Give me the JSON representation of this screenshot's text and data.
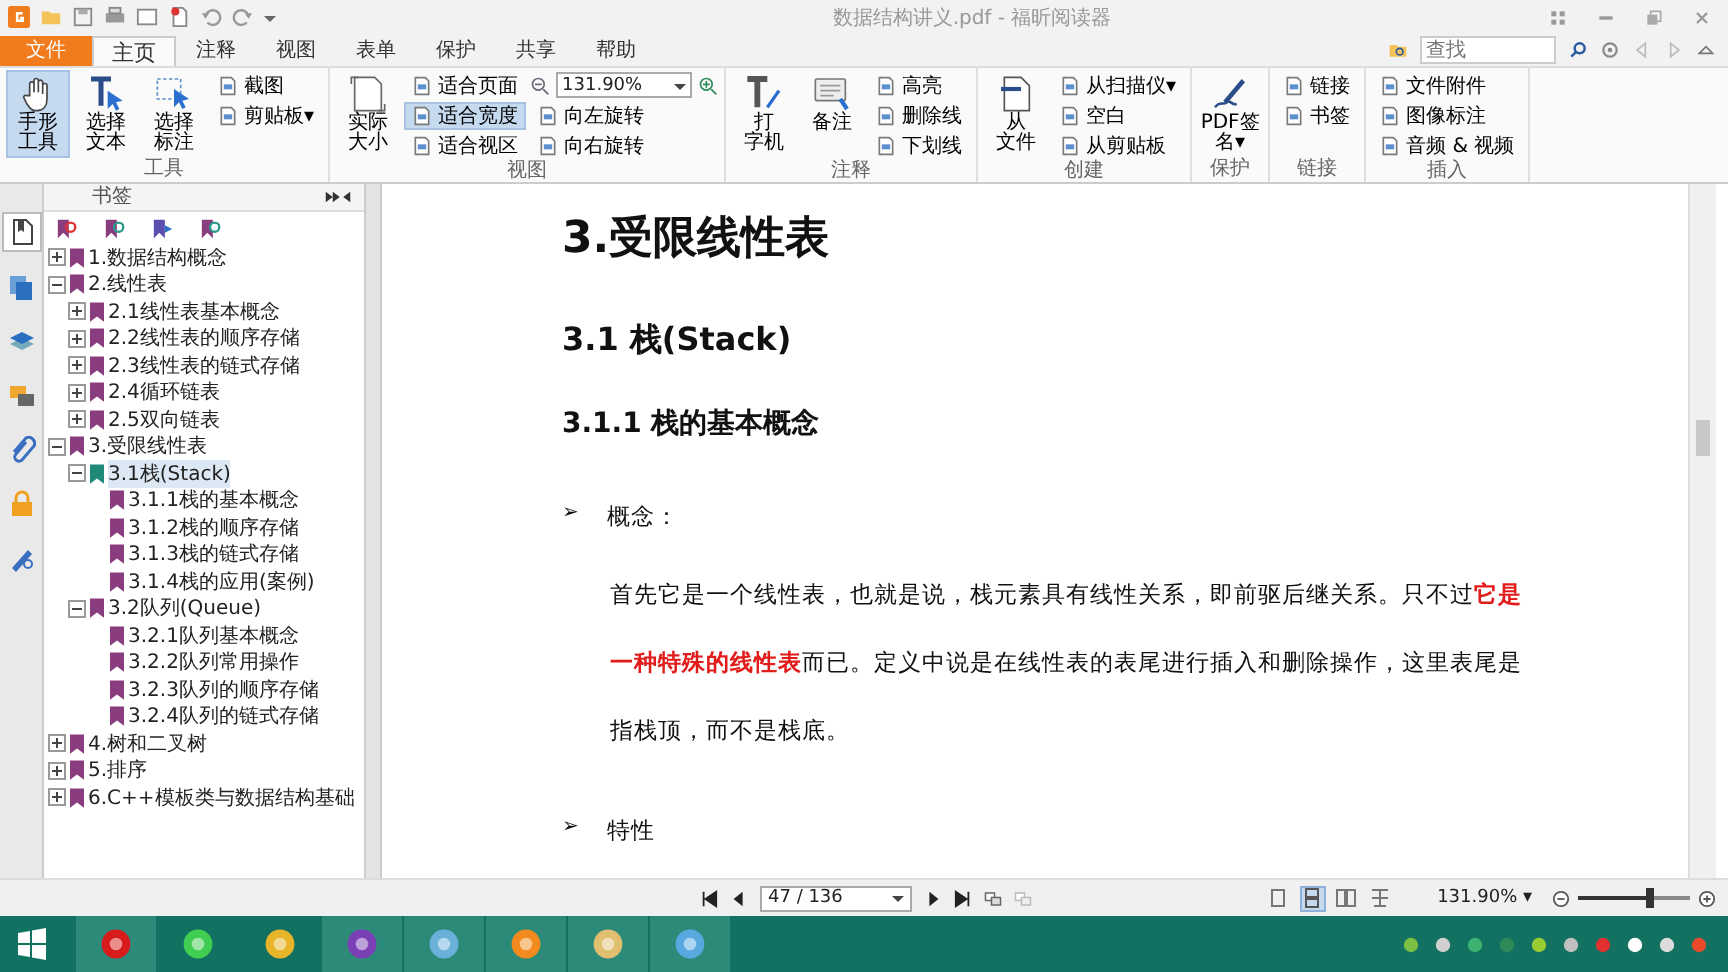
{
  "window": {
    "title": "数据结构讲义.pdf - 福昕阅读器"
  },
  "tabs": [
    {
      "label": "文件",
      "kind": "file",
      "selected": false
    },
    {
      "label": "主页",
      "kind": "tab",
      "selected": true
    },
    {
      "label": "注释",
      "kind": "tab",
      "selected": false
    },
    {
      "label": "视图",
      "kind": "tab",
      "selected": false
    },
    {
      "label": "表单",
      "kind": "tab",
      "selected": false
    },
    {
      "label": "保护",
      "kind": "tab",
      "selected": false
    },
    {
      "label": "共享",
      "kind": "tab",
      "selected": false
    },
    {
      "label": "帮助",
      "kind": "tab",
      "selected": false
    }
  ],
  "search": {
    "placeholder": "查找"
  },
  "ribbon_groups": [
    {
      "label": "工具",
      "columns": [
        {
          "kind": "large",
          "lines": [
            "手形",
            "工具"
          ],
          "selected": true
        },
        {
          "kind": "large",
          "lines": [
            "选择",
            "文本"
          ],
          "selected": false
        },
        {
          "kind": "large",
          "lines": [
            "选择",
            "标注"
          ],
          "selected": false
        },
        {
          "kind": "stack",
          "items": [
            {
              "kind": "button",
              "label": "截图",
              "selected": false
            },
            {
              "kind": "button",
              "label": "剪贴板",
              "caret": "▾",
              "selected": false
            }
          ]
        }
      ]
    },
    {
      "label": "视图",
      "columns": [
        {
          "kind": "large",
          "lines": [
            "实际",
            "大小"
          ],
          "selected": false
        },
        {
          "kind": "stack",
          "items": [
            {
              "kind": "button",
              "label": "适合页面",
              "selected": false
            },
            {
              "kind": "button",
              "label": "适合宽度",
              "selected": true
            },
            {
              "kind": "button",
              "label": "适合视区",
              "selected": false
            }
          ]
        },
        {
          "kind": "stack",
          "items": [
            {
              "kind": "zoom",
              "value": "131.90%"
            },
            {
              "kind": "button",
              "label": "向左旋转",
              "selected": false
            },
            {
              "kind": "button",
              "label": "向右旋转",
              "selected": false
            }
          ]
        }
      ]
    },
    {
      "label": "注释",
      "columns": [
        {
          "kind": "large",
          "lines": [
            "打",
            "字机"
          ],
          "selected": false
        },
        {
          "kind": "large",
          "lines": [
            "备注"
          ],
          "selected": false
        },
        {
          "kind": "stack",
          "items": [
            {
              "kind": "button",
              "label": "高亮",
              "selected": false
            },
            {
              "kind": "button",
              "label": "删除线",
              "selected": false
            },
            {
              "kind": "button",
              "label": "下划线",
              "selected": false
            }
          ]
        }
      ]
    },
    {
      "label": "创建",
      "columns": [
        {
          "kind": "large",
          "lines": [
            "从",
            "文件"
          ],
          "selected": false
        },
        {
          "kind": "stack",
          "items": [
            {
              "kind": "button",
              "label": "从扫描仪",
              "caret": "▾",
              "selected": false
            },
            {
              "kind": "button",
              "label": "空白",
              "selected": false
            },
            {
              "kind": "button",
              "label": "从剪贴板",
              "selected": false
            }
          ]
        }
      ]
    },
    {
      "label": "保护",
      "columns": [
        {
          "kind": "large",
          "lines": [
            "PDF签",
            "名▾"
          ],
          "selected": false
        }
      ]
    },
    {
      "label": "链接",
      "columns": [
        {
          "kind": "stack",
          "items": [
            {
              "kind": "button",
              "label": "链接",
              "selected": false
            },
            {
              "kind": "button",
              "label": "书签",
              "selected": false
            }
          ]
        }
      ]
    },
    {
      "label": "插入",
      "columns": [
        {
          "kind": "stack",
          "items": [
            {
              "kind": "button",
              "label": "文件附件",
              "selected": false
            },
            {
              "kind": "button",
              "label": "图像标注",
              "selected": false
            },
            {
              "kind": "button",
              "label": "音频 & 视频",
              "selected": false
            }
          ]
        }
      ]
    }
  ],
  "sidebar": {
    "title": "书签",
    "panels": [
      {
        "selected": true
      },
      {
        "selected": false
      },
      {
        "selected": false
      },
      {
        "selected": false
      },
      {
        "selected": false
      },
      {
        "selected": false
      },
      {
        "selected": false
      }
    ],
    "bookmarks": [
      {
        "label": "1.数据结构概念",
        "kind": "branch",
        "expanded": false,
        "selected": false
      },
      {
        "label": "2.线性表",
        "kind": "branch",
        "expanded": true,
        "selected": false,
        "children": [
          {
            "label": "2.1线性表基本概念",
            "kind": "branch",
            "expanded": false,
            "selected": false
          },
          {
            "label": "2.2线性表的顺序存储",
            "kind": "branch",
            "expanded": false,
            "selected": false
          },
          {
            "label": "2.3线性表的链式存储",
            "kind": "branch",
            "expanded": false,
            "selected": false
          },
          {
            "label": "2.4循环链表",
            "kind": "branch",
            "expanded": false,
            "selected": false
          },
          {
            "label": "2.5双向链表",
            "kind": "branch",
            "expanded": false,
            "selected": false
          }
        ]
      },
      {
        "label": "3.受限线性表",
        "kind": "branch",
        "expanded": true,
        "selected": false,
        "children": [
          {
            "label": "3.1栈(Stack)",
            "kind": "branch",
            "expanded": true,
            "selected": true,
            "children": [
              {
                "label": "3.1.1栈的基本概念",
                "kind": "leaf",
                "selected": false
              },
              {
                "label": "3.1.2栈的顺序存储",
                "kind": "leaf",
                "selected": false
              },
              {
                "label": "3.1.3栈的链式存储",
                "kind": "leaf",
                "selected": false
              },
              {
                "label": "3.1.4栈的应用(案例)",
                "kind": "leaf",
                "selected": false
              }
            ]
          },
          {
            "label": "3.2队列(Queue)",
            "kind": "branch",
            "expanded": true,
            "selected": false,
            "children": [
              {
                "label": "3.2.1队列基本概念",
                "kind": "leaf",
                "selected": false
              },
              {
                "label": "3.2.2队列常用操作",
                "kind": "leaf",
                "selected": false
              },
              {
                "label": "3.2.3队列的顺序存储",
                "kind": "leaf",
                "selected": false
              },
              {
                "label": "3.2.4队列的链式存储",
                "kind": "leaf",
                "selected": false
              }
            ]
          }
        ]
      },
      {
        "label": "4.树和二叉树",
        "kind": "branch",
        "expanded": false,
        "selected": false
      },
      {
        "label": "5.排序",
        "kind": "branch",
        "expanded": false,
        "selected": false
      },
      {
        "label": "6.C++模板类与数据结构基础",
        "kind": "branch",
        "expanded": false,
        "selected": false
      }
    ]
  },
  "document": {
    "blocks": [
      {
        "kind": "h1",
        "text": "3.受限线性表"
      },
      {
        "kind": "h2",
        "text": "3.1 栈(Stack)"
      },
      {
        "kind": "h3",
        "text": "3.1.1 栈的基本概念"
      },
      {
        "kind": "bullet",
        "marker": "➢",
        "text": "概念："
      },
      {
        "kind": "para",
        "text": "首先它是一个线性表，也就是说，栈元素具有线性关系，即前驱后继关系。只不过**它是一种特殊的线性表**而已。定义中说是在线性表的表尾进行插入和删除操作，这里表尾是指栈顶，而不是栈底。"
      },
      {
        "kind": "bullet",
        "marker": "➢",
        "text": "特性"
      }
    ]
  },
  "status_bar": {
    "page": "47 / 136",
    "zoom": "131.90%",
    "zoom_caret": "▾",
    "level": 0.65,
    "views": [
      {
        "selected": false
      },
      {
        "selected": true
      },
      {
        "selected": false
      },
      {
        "selected": false
      }
    ]
  },
  "taskbar": {
    "apps": [
      {
        "selected": true
      },
      {
        "selected": false
      },
      {
        "selected": false
      },
      {
        "selected": true
      },
      {
        "selected": true
      },
      {
        "selected": true
      },
      {
        "selected": true
      },
      {
        "selected": true
      }
    ]
  }
}
